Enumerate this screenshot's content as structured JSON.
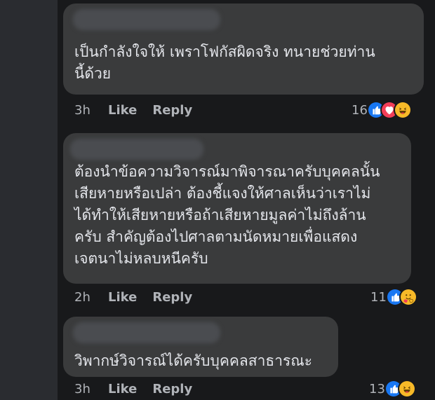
{
  "comments": [
    {
      "text": "เป็นกำลังใจให้ เพราโฟกัสผิดจริง ทนายช่วยท่าน\nนี้ด้วย",
      "time": "3h",
      "like_label": "Like",
      "reply_label": "Reply",
      "reaction_count": "16",
      "reactions": [
        "like-icon",
        "love-icon",
        "haha-icon"
      ]
    },
    {
      "text": "ต้องนำข้อความวิจารณ์มาพิจารณาครับบุคคลนั้น\nเสียหายหรือเปล่า ต้องชี้แจงให้ศาลเห็นว่าเราไม่\nได้ทำให้เสียหายหรือถ้าเสียหายมูลค่าไม่ถึงล้าน\nครับ สำคัญต้องไปศาลตามนัดหมายเพื่อแสดง\nเจตนาไม่หลบหนีครับ",
      "time": "2h",
      "like_label": "Like",
      "reply_label": "Reply",
      "reaction_count": "11",
      "reactions": [
        "like-icon",
        "care-icon"
      ]
    },
    {
      "text": "วิพากษ์วิจารณ์ได้ครับบุคคลสาธารณะ",
      "time": "3h",
      "like_label": "Like",
      "reply_label": "Reply",
      "reaction_count": "13",
      "reactions": [
        "like-icon",
        "haha-icon"
      ]
    }
  ],
  "colors": {
    "background": "#18191b",
    "bubble": "#3a3b3c",
    "text": "#e4e6eb",
    "meta": "#b0b3b8",
    "like_blue": "#1877f2",
    "love_red": "#f33e58",
    "haha_yellow": "#f7b928"
  }
}
